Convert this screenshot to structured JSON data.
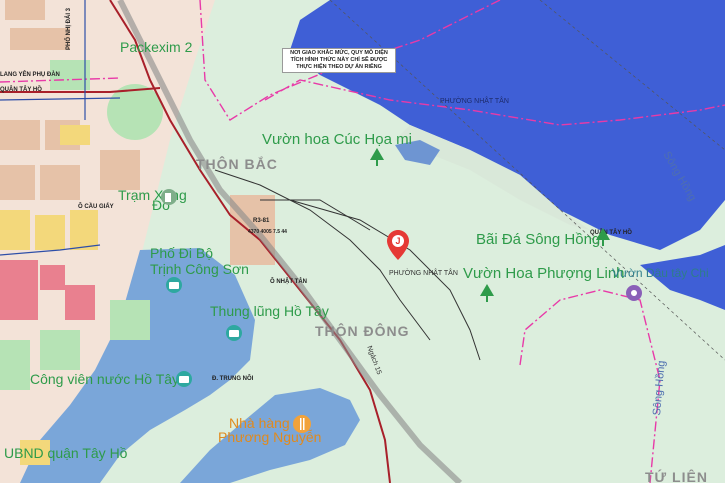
{
  "map": {
    "labels": {
      "ward_top_river": "PHƯỜNG NHẬT TÂN",
      "ward_center": "PHƯỜNG NHẬT TÂN",
      "garden_cuc_hoa_mi": "Vườn hoa Cúc Họa mi",
      "thon_bac": "THÔN BẮC",
      "thon_dong": "THÔN ĐÔNG",
      "bai_da": "Bãi Đá Sông Hồng",
      "vuon_hoa_phuong_linh": "Vườn Hoa Phượng Linh",
      "vuon_dau": "Vườn Dâu tây Chi",
      "song_hong_top": "Sông Hồng",
      "song_hong_bottom": "Sông Hồng",
      "tram_xang": "Trạm Xăng",
      "do": "Đỗ",
      "pho_di_bo": "Phố Đi Bộ",
      "trinh_cong_son": "Trịnh Công Sơn",
      "thung_lung": "Thung lũng Hồ Tây",
      "cong_vien": "Công viên nước Hồ Tây",
      "nha_hang": "Nhà hàng",
      "phuong_nguyen": "Phương Nguyễn",
      "ubnd": "UBND quận Tây Hồ",
      "quan_tay_ho": "QUẬN TÂY HỒ",
      "ngach": "Ngách 15",
      "packexim": "Packexim 2",
      "tu_lien": "TỨ LIÊN",
      "nhat_tan_small": "Ô NHẬT TÂN",
      "au_cau_giay": "Ô CẦU GIẤY",
      "pho_dal": "PHỐ NHỊ ĐẢI 3",
      "small_address": "Đ. TRUNG NÔI",
      "quan_tay_ho_top": "QUẬN TÂY HỒ",
      "nhat_tan_lane": "NHẬT TÂN",
      "yen_phu": "LANG YÊN PHỤ ĐÀN",
      "r3": "R3-81",
      "r3_sub": "4370 4005 7.5 44"
    },
    "note": {
      "text": "NƠI GIAO KHẮC MỨC, QUY MÔ DIỆN TÍCH HÌNH THỨC NÀY CHỈ SẼ ĐƯỢC THỰC HIỆN THEO DỰ ÁN RIÊNG"
    },
    "colors": {
      "river": "#3f5fd6",
      "park": "#dceedd",
      "boundary": "#e83aa8",
      "road_red": "#a8202a",
      "pin": "#e53935"
    },
    "icons": [
      "park-tree-icon",
      "location-pin-icon",
      "restaurant-icon",
      "camera-icon",
      "gas-station-icon"
    ]
  }
}
